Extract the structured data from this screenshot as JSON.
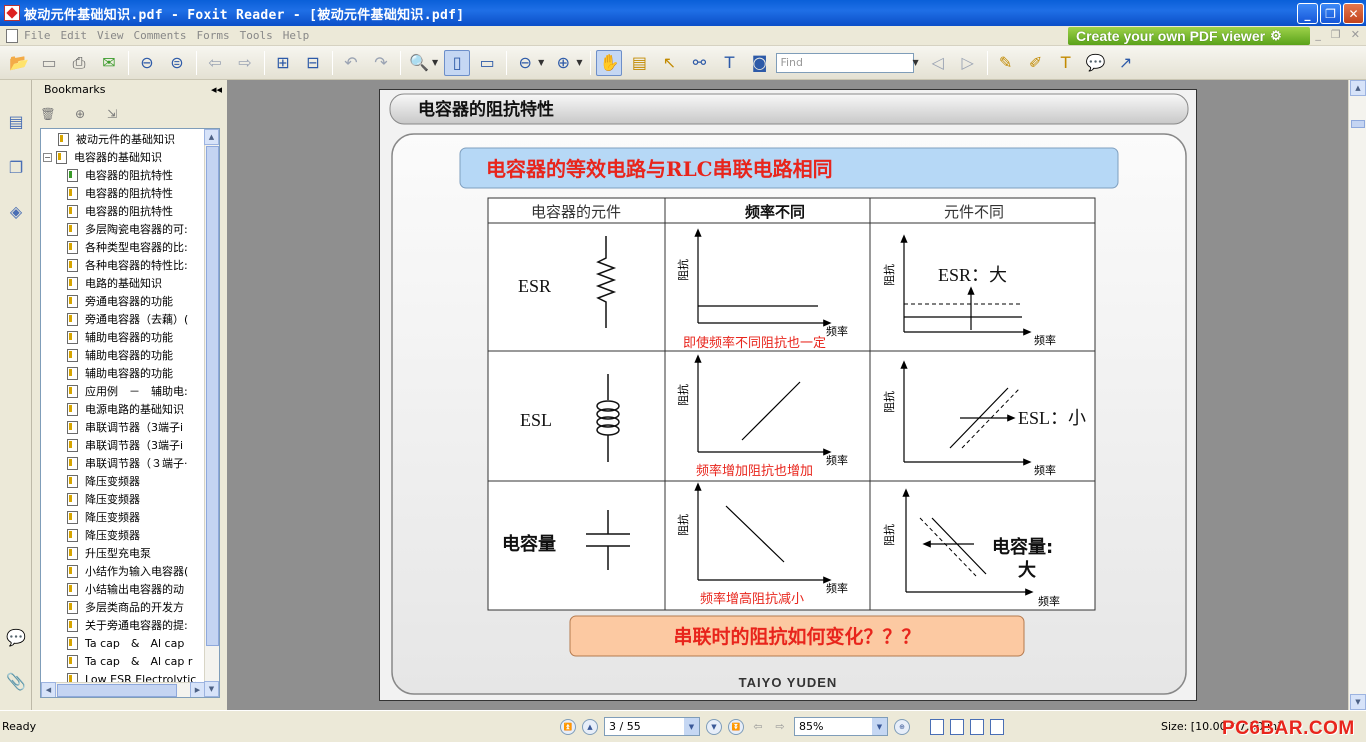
{
  "window": {
    "title": "被动元件基础知识.pdf - Foxit Reader - [被动元件基础知识.pdf]",
    "buttons": [
      "_",
      "❐",
      "✕"
    ]
  },
  "menu": {
    "items": [
      "File",
      "Edit",
      "View",
      "Comments",
      "Forms",
      "Tools",
      "Help"
    ],
    "promo": "Create your own PDF viewer"
  },
  "toolbar": {
    "find_placeholder": "Find",
    "icons": [
      "open-icon",
      "save-icon",
      "print-icon",
      "email-icon",
      "prev-page-icon",
      "next-page-icon",
      "back-icon",
      "forward-icon",
      "insert-page-icon",
      "extract-page-icon",
      "undo-icon",
      "redo-icon",
      "zoom-in-icon",
      "fit-page-icon",
      "fit-width-icon",
      "zoom-out-icon",
      "zoom-plus-icon",
      "hand-tool-icon",
      "text-select-icon",
      "select-icon",
      "binoculars-icon",
      "typewriter-icon",
      "snapshot-icon",
      "pencil-icon",
      "note-icon",
      "highlight-icon",
      "comment-icon",
      "arrow-icon"
    ]
  },
  "bookmarks": {
    "header": "Bookmarks",
    "items": [
      {
        "label": "被动元件的基础知识",
        "level": 0,
        "green": false
      },
      {
        "label": "电容器的基础知识",
        "level": 0,
        "expanded": true,
        "green": false
      },
      {
        "label": "电容器的阻抗特性",
        "level": 1,
        "green": true
      },
      {
        "label": "电容器的阻抗特性",
        "level": 1,
        "green": false
      },
      {
        "label": "电容器的阻抗特性",
        "level": 1,
        "green": false
      },
      {
        "label": "多层陶瓷电容器的可:",
        "level": 1,
        "green": false
      },
      {
        "label": "各种类型电容器的比:",
        "level": 1,
        "green": false
      },
      {
        "label": "各种电容器的特性比:",
        "level": 1,
        "green": false
      },
      {
        "label": "电路的基础知识",
        "level": 1,
        "green": false
      },
      {
        "label": "旁通电容器的功能",
        "level": 1,
        "green": false
      },
      {
        "label": "旁通电容器（去藕）(",
        "level": 1,
        "green": false
      },
      {
        "label": "辅助电容器的功能",
        "level": 1,
        "green": false
      },
      {
        "label": "辅助电容器的功能",
        "level": 1,
        "green": false
      },
      {
        "label": "辅助电容器的功能",
        "level": 1,
        "green": false
      },
      {
        "label": "应用例　－　辅助电:",
        "level": 1,
        "green": false
      },
      {
        "label": "电源电路的基础知识",
        "level": 1,
        "green": false
      },
      {
        "label": "串联调节器（3端子i",
        "level": 1,
        "green": false
      },
      {
        "label": "串联调节器（3端子i",
        "level": 1,
        "green": false
      },
      {
        "label": "串联调节器（３端子·",
        "level": 1,
        "green": false
      },
      {
        "label": "降压变频器",
        "level": 1,
        "green": false
      },
      {
        "label": "降压变频器",
        "level": 1,
        "green": false
      },
      {
        "label": "降压变频器",
        "level": 1,
        "green": false
      },
      {
        "label": "降压变频器",
        "level": 1,
        "green": false
      },
      {
        "label": "升压型充电泵",
        "level": 1,
        "green": false
      },
      {
        "label": "小结作为输入电容器(",
        "level": 1,
        "green": false
      },
      {
        "label": "小结输出电容器的动",
        "level": 1,
        "green": false
      },
      {
        "label": "多层类商品的开发方",
        "level": 1,
        "green": false
      },
      {
        "label": "关于旁通电容器的提:",
        "level": 1,
        "green": false
      },
      {
        "label": "Ta cap　&　Al cap",
        "level": 1,
        "green": false
      },
      {
        "label": "Ta cap　&　Al cap r",
        "level": 1,
        "green": false
      },
      {
        "label": "Low ESR Electrolytic",
        "level": 1,
        "green": false
      }
    ]
  },
  "slide": {
    "header": "电容器的阻抗特性",
    "banner": "电容器的等效电路与RLC串联电路相同",
    "table_headers": [
      "电容器的元件",
      "频率不同",
      "元件不同"
    ],
    "rows": [
      {
        "element": "ESR",
        "freq_caption": "即使频率不同阻抗也一定",
        "diff_label": "ESR：大"
      },
      {
        "element": "ESL",
        "freq_caption": "频率增加阻抗也增加",
        "diff_label": "ESL：小"
      },
      {
        "element": "电容量",
        "freq_caption": "频率增高阻抗减小",
        "diff_label_1": "电容量:",
        "diff_label_2": "大"
      }
    ],
    "axis_y": "阻抗",
    "axis_x": "频率",
    "question": "串联时的阻抗如何变化？？？",
    "footer_logo": "TAIYO YUDEN"
  },
  "status": {
    "text": "Ready",
    "page_value": "3 / 55",
    "zoom_value": "85%",
    "size_text": "Size: [10.00 * 7.50 in]",
    "watermark": "PC6BAR.COM"
  },
  "colors": {
    "slide_red": "#e8251c",
    "banner_blue": "#b6d8f6",
    "question_orange": "#fcc9a2"
  }
}
